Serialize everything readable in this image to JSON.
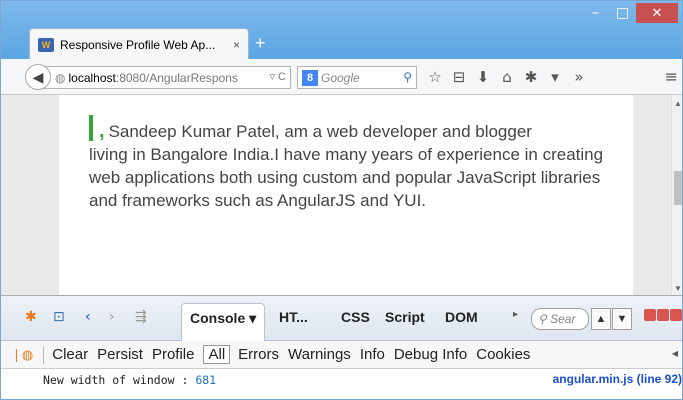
{
  "window": {
    "minimize": "–",
    "maximize": "□",
    "close": "✕"
  },
  "tab": {
    "favicon": "W",
    "title": "Responsive Profile Web Ap...",
    "close": "×",
    "new_tab": "+"
  },
  "navbar": {
    "url_host": "localhost",
    "url_rest": ":8080/AngularRespons",
    "url_right": "▿ C",
    "search_engine": "8",
    "search_placeholder": "Google",
    "icons": [
      "☆",
      "⊟",
      "⬇",
      "⌂",
      "✱",
      "▾",
      "»"
    ],
    "menu": "≡"
  },
  "content": {
    "bio_intro": "Sandeep Kumar Patel, am a web developer and blogger",
    "bio_rest": "living in Bangalore India.I have many years of experience in creating web applications both using custom and popular JavaScript libraries and frameworks such as AngularJS and YUI.",
    "comma": ","
  },
  "firebug": {
    "tabs": [
      "Console ▾",
      "HT...",
      "CSS",
      "Script",
      "DOM"
    ],
    "search_placeholder": "Sear",
    "toolbar": [
      "Clear",
      "Persist",
      "Profile",
      "All",
      "Errors",
      "Warnings",
      "Info",
      "Debug Info",
      "Cookies"
    ],
    "log": {
      "text": "New width of window : ",
      "value": "681",
      "source": "angular.min.js (line 92)"
    }
  }
}
